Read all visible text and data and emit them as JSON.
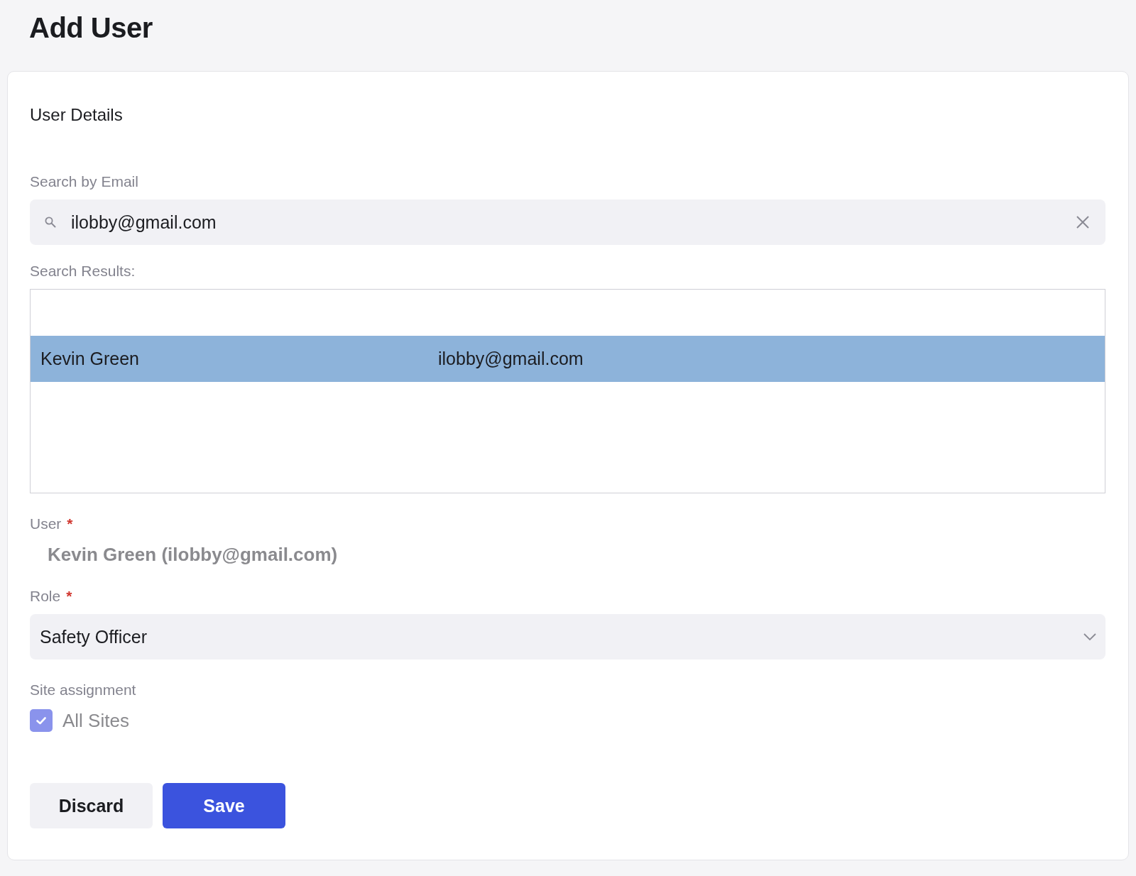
{
  "page_title": "Add User",
  "section_title": "User Details",
  "search": {
    "label": "Search by Email",
    "value": "ilobby@gmail.com"
  },
  "results": {
    "label": "Search Results:",
    "rows": [
      {
        "name": "Kevin Green",
        "email": "ilobby@gmail.com",
        "selected": true
      }
    ]
  },
  "user": {
    "label": "User",
    "required_mark": "*",
    "value": "Kevin Green (ilobby@gmail.com)"
  },
  "role": {
    "label": "Role",
    "required_mark": "*",
    "value": "Safety Officer"
  },
  "site_assignment": {
    "label": "Site assignment",
    "option": {
      "label": "All Sites",
      "checked": true
    }
  },
  "buttons": [
    {
      "label": "Discard",
      "kind": "secondary"
    },
    {
      "label": "Save",
      "kind": "primary"
    }
  ]
}
